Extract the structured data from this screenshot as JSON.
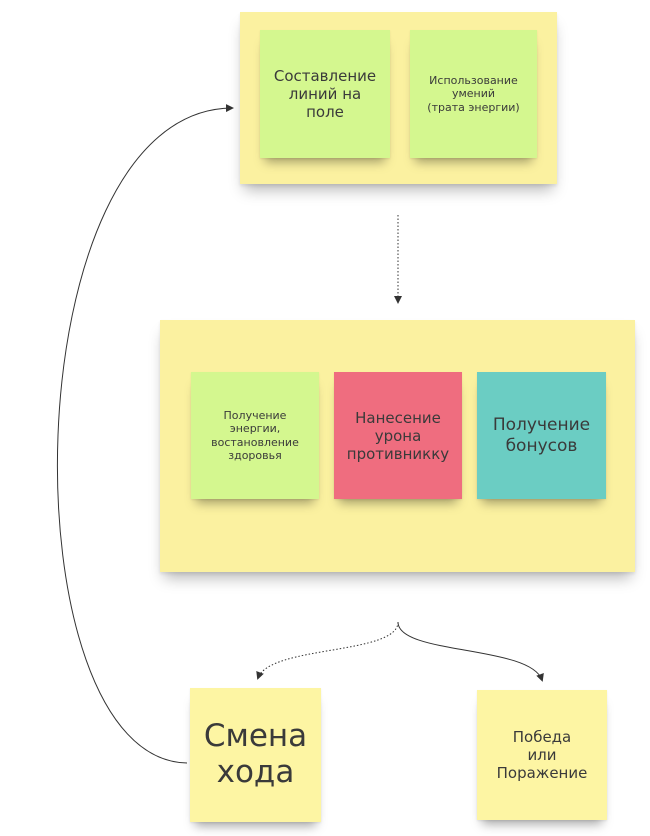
{
  "board": {
    "top_group": {
      "notes": [
        {
          "text": "Составление\nлиний на\nполе",
          "color": "#d4f78f"
        },
        {
          "text": "Использование\nумений\n(трата энергии)",
          "color": "#d4f78f"
        }
      ]
    },
    "middle_group": {
      "notes": [
        {
          "text": "Получение\nэнергии,\nвостановление\nздоровья",
          "color": "#d4f78f"
        },
        {
          "text": "Нанесение\nурона\nпротивникку",
          "color": "#ef6d7f"
        },
        {
          "text": "Получение\nбонусов",
          "color": "#6bcdc3"
        }
      ]
    },
    "bottom_notes": [
      {
        "text": "Смена\nхода",
        "color": "#fdf5a3"
      },
      {
        "text": "Победа\nили\nПоражение",
        "color": "#fdf5a3"
      }
    ],
    "frame_color": "#fbf1a0",
    "connector_color": "#333333"
  }
}
